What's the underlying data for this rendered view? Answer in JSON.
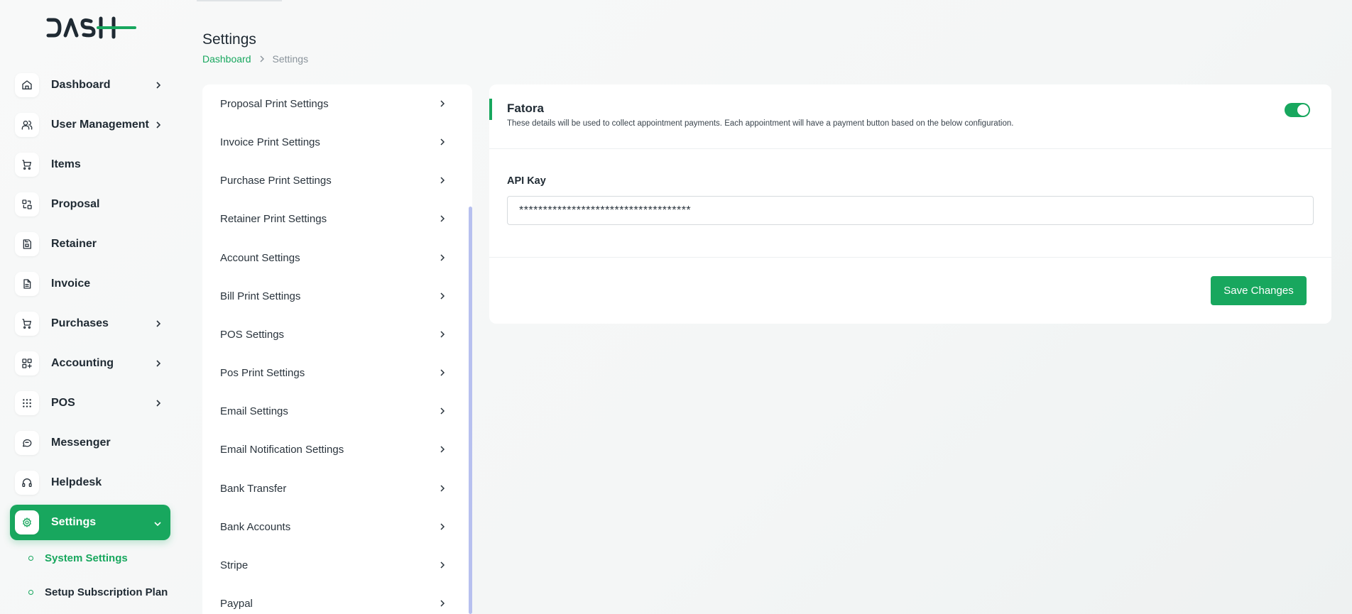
{
  "brand": {
    "logo_text": "DASH",
    "accent": "#18a75e"
  },
  "sidebar": {
    "items": [
      {
        "label": "Dashboard",
        "icon": "home-icon",
        "has_chevron": true
      },
      {
        "label": "User Management",
        "icon": "users-icon",
        "has_chevron": true
      },
      {
        "label": "Items",
        "icon": "cart-icon",
        "has_chevron": false
      },
      {
        "label": "Proposal",
        "icon": "replace-icon",
        "has_chevron": false
      },
      {
        "label": "Retainer",
        "icon": "save-file-icon",
        "has_chevron": false
      },
      {
        "label": "Invoice",
        "icon": "file-icon",
        "has_chevron": false
      },
      {
        "label": "Purchases",
        "icon": "cart-icon",
        "has_chevron": true
      },
      {
        "label": "Accounting",
        "icon": "apps-plus-icon",
        "has_chevron": true
      },
      {
        "label": "POS",
        "icon": "grid-dots-icon",
        "has_chevron": true
      },
      {
        "label": "Messenger",
        "icon": "message-icon",
        "has_chevron": false
      },
      {
        "label": "Helpdesk",
        "icon": "headset-icon",
        "has_chevron": false
      },
      {
        "label": "Settings",
        "icon": "gear-icon",
        "has_chevron": true,
        "active": true
      }
    ],
    "sub_items": [
      {
        "label": "System Settings",
        "current": true
      },
      {
        "label": "Setup Subscription Plan",
        "current": false
      }
    ]
  },
  "header": {
    "title": "Settings",
    "breadcrumb": {
      "link": "Dashboard",
      "current": "Settings"
    }
  },
  "settings_menu": [
    "Proposal Print Settings",
    "Invoice Print Settings",
    "Purchase Print Settings",
    "Retainer Print Settings",
    "Account Settings",
    "Bill Print Settings",
    "POS Settings",
    "Pos Print Settings",
    "Email Settings",
    "Email Notification Settings",
    "Bank Transfer",
    "Bank Accounts",
    "Stripe",
    "Paypal"
  ],
  "fatora": {
    "title": "Fatora",
    "description": "These details will be used to collect appointment payments. Each appointment will have a payment button based on the below configuration.",
    "enabled": true,
    "api_key_label": "API Kay",
    "api_key_value": "************************************",
    "save_label": "Save Changes"
  }
}
